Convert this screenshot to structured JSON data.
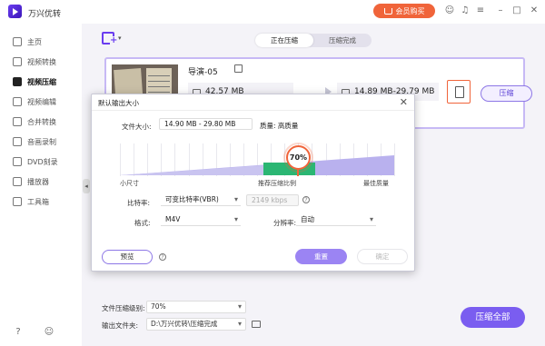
{
  "app": {
    "title": "万兴优转",
    "buy_label": "会员购买"
  },
  "sidebar": {
    "items": [
      {
        "label": "主页",
        "active": false
      },
      {
        "label": "视频转换",
        "active": false
      },
      {
        "label": "视频压缩",
        "active": true
      },
      {
        "label": "视频编辑",
        "active": false
      },
      {
        "label": "合并转换",
        "active": false
      },
      {
        "label": "音画录制",
        "active": false
      },
      {
        "label": "DVD刻录",
        "active": false
      },
      {
        "label": "播放器",
        "active": false
      },
      {
        "label": "工具箱",
        "active": false
      }
    ]
  },
  "tabs": [
    {
      "label": "正在压缩",
      "active": true
    },
    {
      "label": "压缩完成",
      "active": false
    }
  ],
  "file": {
    "name": "导演-05",
    "original_size": "42.57 MB",
    "target_size": "14.89 MB-29.79 MB",
    "compress_label": "压缩"
  },
  "bottom": {
    "level_label": "文件压缩级别:",
    "level_value": "70%",
    "output_label": "输出文件夹:",
    "output_value": "D:\\万兴优转\\压缩完成",
    "compress_all_label": "压缩全部"
  },
  "dialog": {
    "title": "默认输出大小",
    "size_label": "文件大小:",
    "size_value": "14.90 MB - 29.80 MB",
    "quality_label": "质量:",
    "quality_value": "高质量",
    "slider_percent": 70,
    "slider_left": "小尺寸",
    "slider_mid": "推荐压缩比例",
    "slider_right": "最佳质量",
    "bitrate_label": "比特率:",
    "bitrate_value": "可变比特率(VBR)",
    "bitrate_kbps": "2149 kbps",
    "format_label": "格式:",
    "format_value": "M4V",
    "resolution_label": "分辨率:",
    "resolution_value": "自动",
    "preview_label": "预览",
    "save_label": "重置",
    "ok_label": "确定"
  },
  "colors": {
    "accent": "#7a5df0",
    "orange": "#f0643a",
    "green": "#2bb673"
  }
}
